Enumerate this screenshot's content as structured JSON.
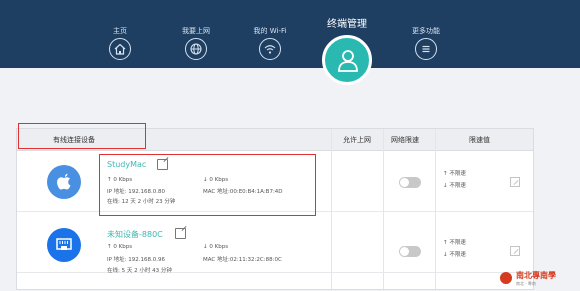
{
  "nav": {
    "home": "主页",
    "internet": "我要上网",
    "wifi": "我的 Wi-Fi",
    "terminal": "终端管理",
    "more": "更多功能"
  },
  "table": {
    "header_device": "有线连接设备",
    "header_allow": "允许上网",
    "header_net_limit": "网络限速",
    "header_limit_value": "限速值"
  },
  "devices": [
    {
      "name": "StudyMac",
      "up": "↑ 0 Kbps",
      "down": "↓ 0 Kbps",
      "ip": "IP 地址: 192.168.0.80",
      "mac": "MAC 地址:00:E0:B4:1A:B7:4D",
      "online": "在线: 12 天 2 小时 23 分钟",
      "limit_up": "↑ 不限速",
      "limit_down": "↓ 不限速",
      "icon": "apple-icon",
      "color": "#4a90e2"
    },
    {
      "name": "未知设备-880C",
      "up": "↑ 0 Kbps",
      "down": "↓ 0 Kbps",
      "ip": "IP 地址: 192.168.0.96",
      "mac": "MAC 地址:02:11:32:2C:88:0C",
      "online": "在线: 5 天 2 小时 43 分钟",
      "limit_up": "↑ 不限速",
      "limit_down": "↓ 不限速",
      "icon": "ethernet-port-icon",
      "color": "#1a73e8"
    }
  ],
  "watermark": {
    "title": "南北專南學",
    "sub": "南北 · 專南"
  },
  "colors": {
    "topbar": "#1f3f62",
    "accent": "#29b9b1",
    "highlight": "#e03131"
  }
}
